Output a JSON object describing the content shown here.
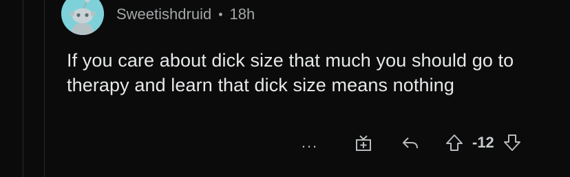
{
  "comment": {
    "username": "Sweetishdruid",
    "separator": "•",
    "time_ago": "18h",
    "body": "If you care about dick size that much you should go to therapy and learn that dick size means nothing",
    "score": "-12",
    "avatar_color": "#7fd1d9"
  },
  "actions": {
    "more_label": "...",
    "icons": {
      "more": "more-icon",
      "award": "gift-icon",
      "reply": "reply-icon",
      "upvote": "upvote-icon",
      "downvote": "downvote-icon"
    }
  },
  "colors": {
    "background": "#0b0b0b",
    "text": "#e6e8ea",
    "meta": "#a3a6a8",
    "thread_line": "#2a2a2a"
  }
}
